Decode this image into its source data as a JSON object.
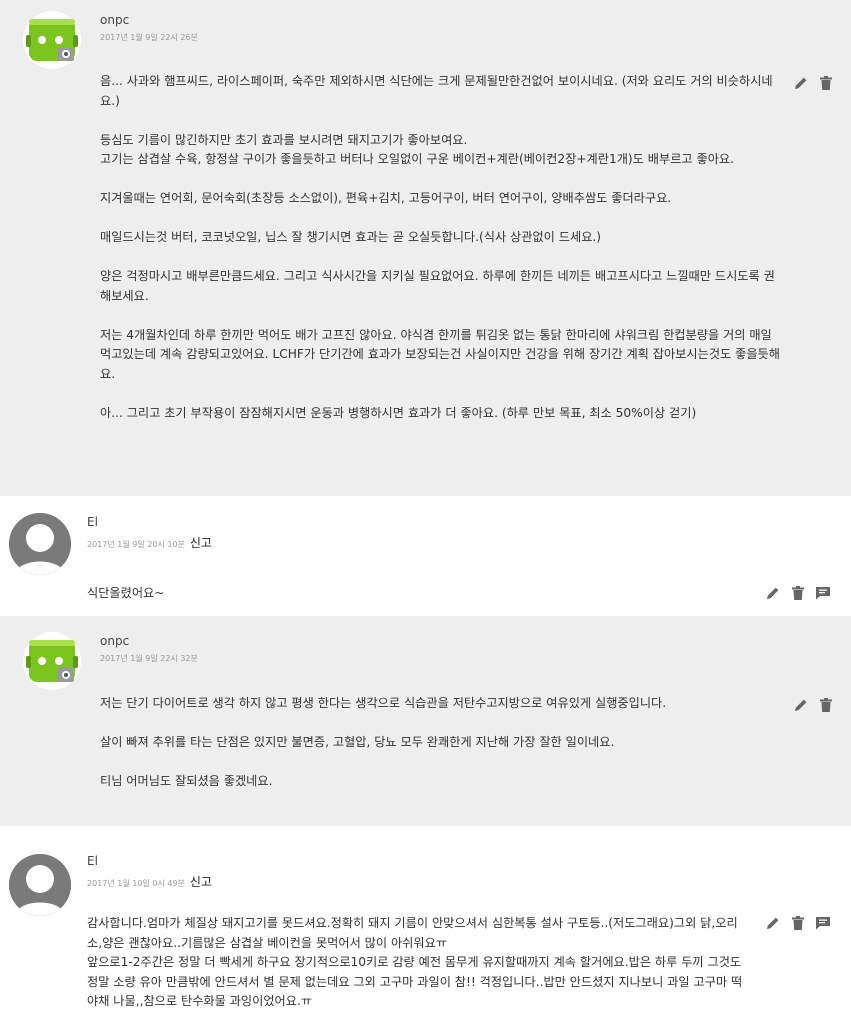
{
  "comments": [
    {
      "author": "onpc",
      "date": "2017년 1월 9일 22시 26분",
      "paragraphs": [
        "음... 사과와 햄프씨드, 라이스페이퍼, 숙주만 제외하시면 식단에는 크게 문제될만한건없어 보이시네요. (저와 요리도 거의 비슷하시네요.)",
        "등심도 기름이 많긴하지만 초기 효과를 보시려면 돼지고기가 좋아보여요.\n고기는 삼겹살 수육, 항정살 구이가 좋을듯하고 버터나 오일없이 구운 베이컨+계란(베이컨2장+계란1개)도 배부르고 좋아요.",
        "지겨울때는 연어회, 문어숙회(초장등 소스없이), 편육+김치, 고등어구이, 버터 연어구이, 양배추쌈도 좋더라구요.",
        "매일드시는것 버터, 코코넛오일, 닙스 잘 챙기시면 효과는 곧 오실듯합니다.(식사 상관없이 드세요.)",
        "양은 걱정마시고 배부른만큼드세요. 그리고 식사시간을 지키실 필요없어요. 하루에 한끼든 네끼든 배고프시다고 느낄때만 드시도록 권해보세요.",
        "저는 4개월차인데 하루 한끼만 먹어도 배가 고프진 않아요. 야식겸 한끼를 튀김옷 없는 통닭 한마리에 샤워크림 한컵분량을 거의 매일 먹고있는데 계속 감량되고있어요. LCHF가 단기간에 효과가 보장되는건 사실이지만 건강을 위해 장기간 계획 잡아보시는것도 좋을듯해요.",
        "아... 그리고 초기 부작용이 잠잠해지시면 운동과 병행하시면 효과가 더 좋아요. (하루 만보 목표, 최소 50%이상 걷기)"
      ]
    },
    {
      "author": "El",
      "date": "2017년 1월 9일 20시 10분",
      "report": "신고",
      "paragraphs": [
        "식단올렸어요~"
      ]
    },
    {
      "author": "onpc",
      "date": "2017년 1월 9일 22시 32분",
      "paragraphs": [
        "저는 단기 다이어트로 생각 하지 않고 평생 한다는 생각으로 식습관을 저탄수고지방으로 여유있게 실행중입니다.",
        "살이 빠져 추위를 타는 단점은 있지만 불면증, 고혈압, 당뇨 모두 완쾌한게 지난해 가장 잘한 일이네요.",
        "티님 어머님도 잘되셨음 좋겠네요."
      ]
    },
    {
      "author": "El",
      "date": "2017년 1월 10일 0시 49분",
      "report": "신고",
      "paragraphs": [
        "감사합니다.엄마가 체질상 돼지고기를 못드셔요.정확히 돼지 기름이 안맞으셔서 심한복통 설사 구토등..(저도그래요)그외 닭,오리 소,양은 괜찮아요..기름많은 삼겹살 베이컨을 못먹어서 많이 아쉬워요ㅠ\n앞으로1-2주간은 정말 더 빡세게 하구요 장기적으로10키로 감량 예전 몸무게 유지할때까지 계속 할거에요.밥은 하루 두끼 그것도 정말 소량 유아 만큼밖에 안드셔서 별 문제 없는데요 그외 고구마 과일이 참!! 걱정입니다..밥만 안드셨지 지나보니 과일 고구마 떡 야채 나물,,참으로 탄수화물 과잉이었어요.ㅠ"
      ]
    }
  ],
  "icons": {
    "edit": "pencil-icon",
    "delete": "trash-icon",
    "reply": "comment-icon"
  },
  "colors": {
    "reply_bg": "#eeeeee",
    "icon": "#666666",
    "avatar_green": "#7cc41e"
  }
}
